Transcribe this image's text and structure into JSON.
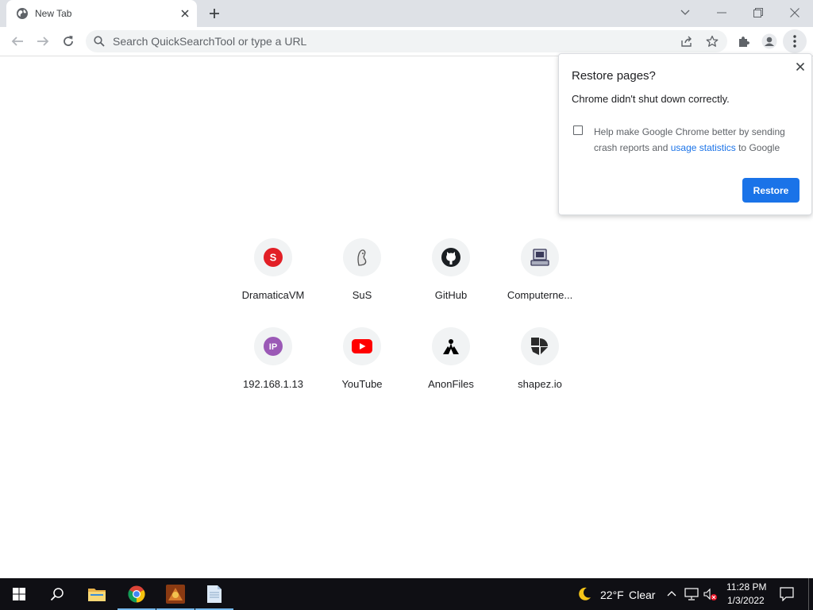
{
  "tab": {
    "title": "New Tab",
    "favicon": "globe-icon"
  },
  "toolbar": {
    "back": "arrow-left-icon",
    "forward": "arrow-right-icon",
    "reload": "reload-icon",
    "omnibox_placeholder": "Search QuickSearchTool or type a URL",
    "share": "share-icon",
    "bookmark": "star-icon",
    "extensions": "puzzle-icon",
    "profile": "person-icon",
    "menu": "kebab-menu-icon"
  },
  "shortcuts": [
    {
      "label": "DramaticaVM",
      "icon": "s-letter-icon",
      "color": "#e21f26"
    },
    {
      "label": "SuS",
      "icon": "ghost-icon",
      "color": "#555555"
    },
    {
      "label": "GitHub",
      "icon": "github-icon",
      "color": "#1b1f23"
    },
    {
      "label": "Computerne...",
      "icon": "computer-icon",
      "color": "#3a3a5a"
    },
    {
      "label": "192.168.1.13",
      "icon": "ip-letter-icon",
      "color": "#9b59b6"
    },
    {
      "label": "YouTube",
      "icon": "youtube-icon",
      "color": "#ff0000"
    },
    {
      "label": "AnonFiles",
      "icon": "anon-icon",
      "color": "#000000"
    },
    {
      "label": "shapez.io",
      "icon": "shapez-icon",
      "color": "#2b2b2b"
    }
  ],
  "restore_bubble": {
    "title": "Restore pages?",
    "message": "Chrome didn't shut down correctly.",
    "checkbox_text_before": "Help make Google Chrome better by sending crash reports and ",
    "checkbox_link": "usage statistics",
    "checkbox_text_after": " to Google",
    "checked": false,
    "restore_button": "Restore"
  },
  "taskbar": {
    "weather_icon": "moon-icon",
    "temperature": "22°F",
    "condition": "Clear",
    "time": "11:28 PM",
    "date": "1/3/2022",
    "apps": [
      "start-icon",
      "search-icon",
      "file-explorer-icon",
      "chrome-icon",
      "game-app-icon",
      "notepad-icon"
    ]
  },
  "colors": {
    "accent": "#1a73e8",
    "tabstrip": "#dee1e6",
    "taskbar": "#0f0f14"
  }
}
